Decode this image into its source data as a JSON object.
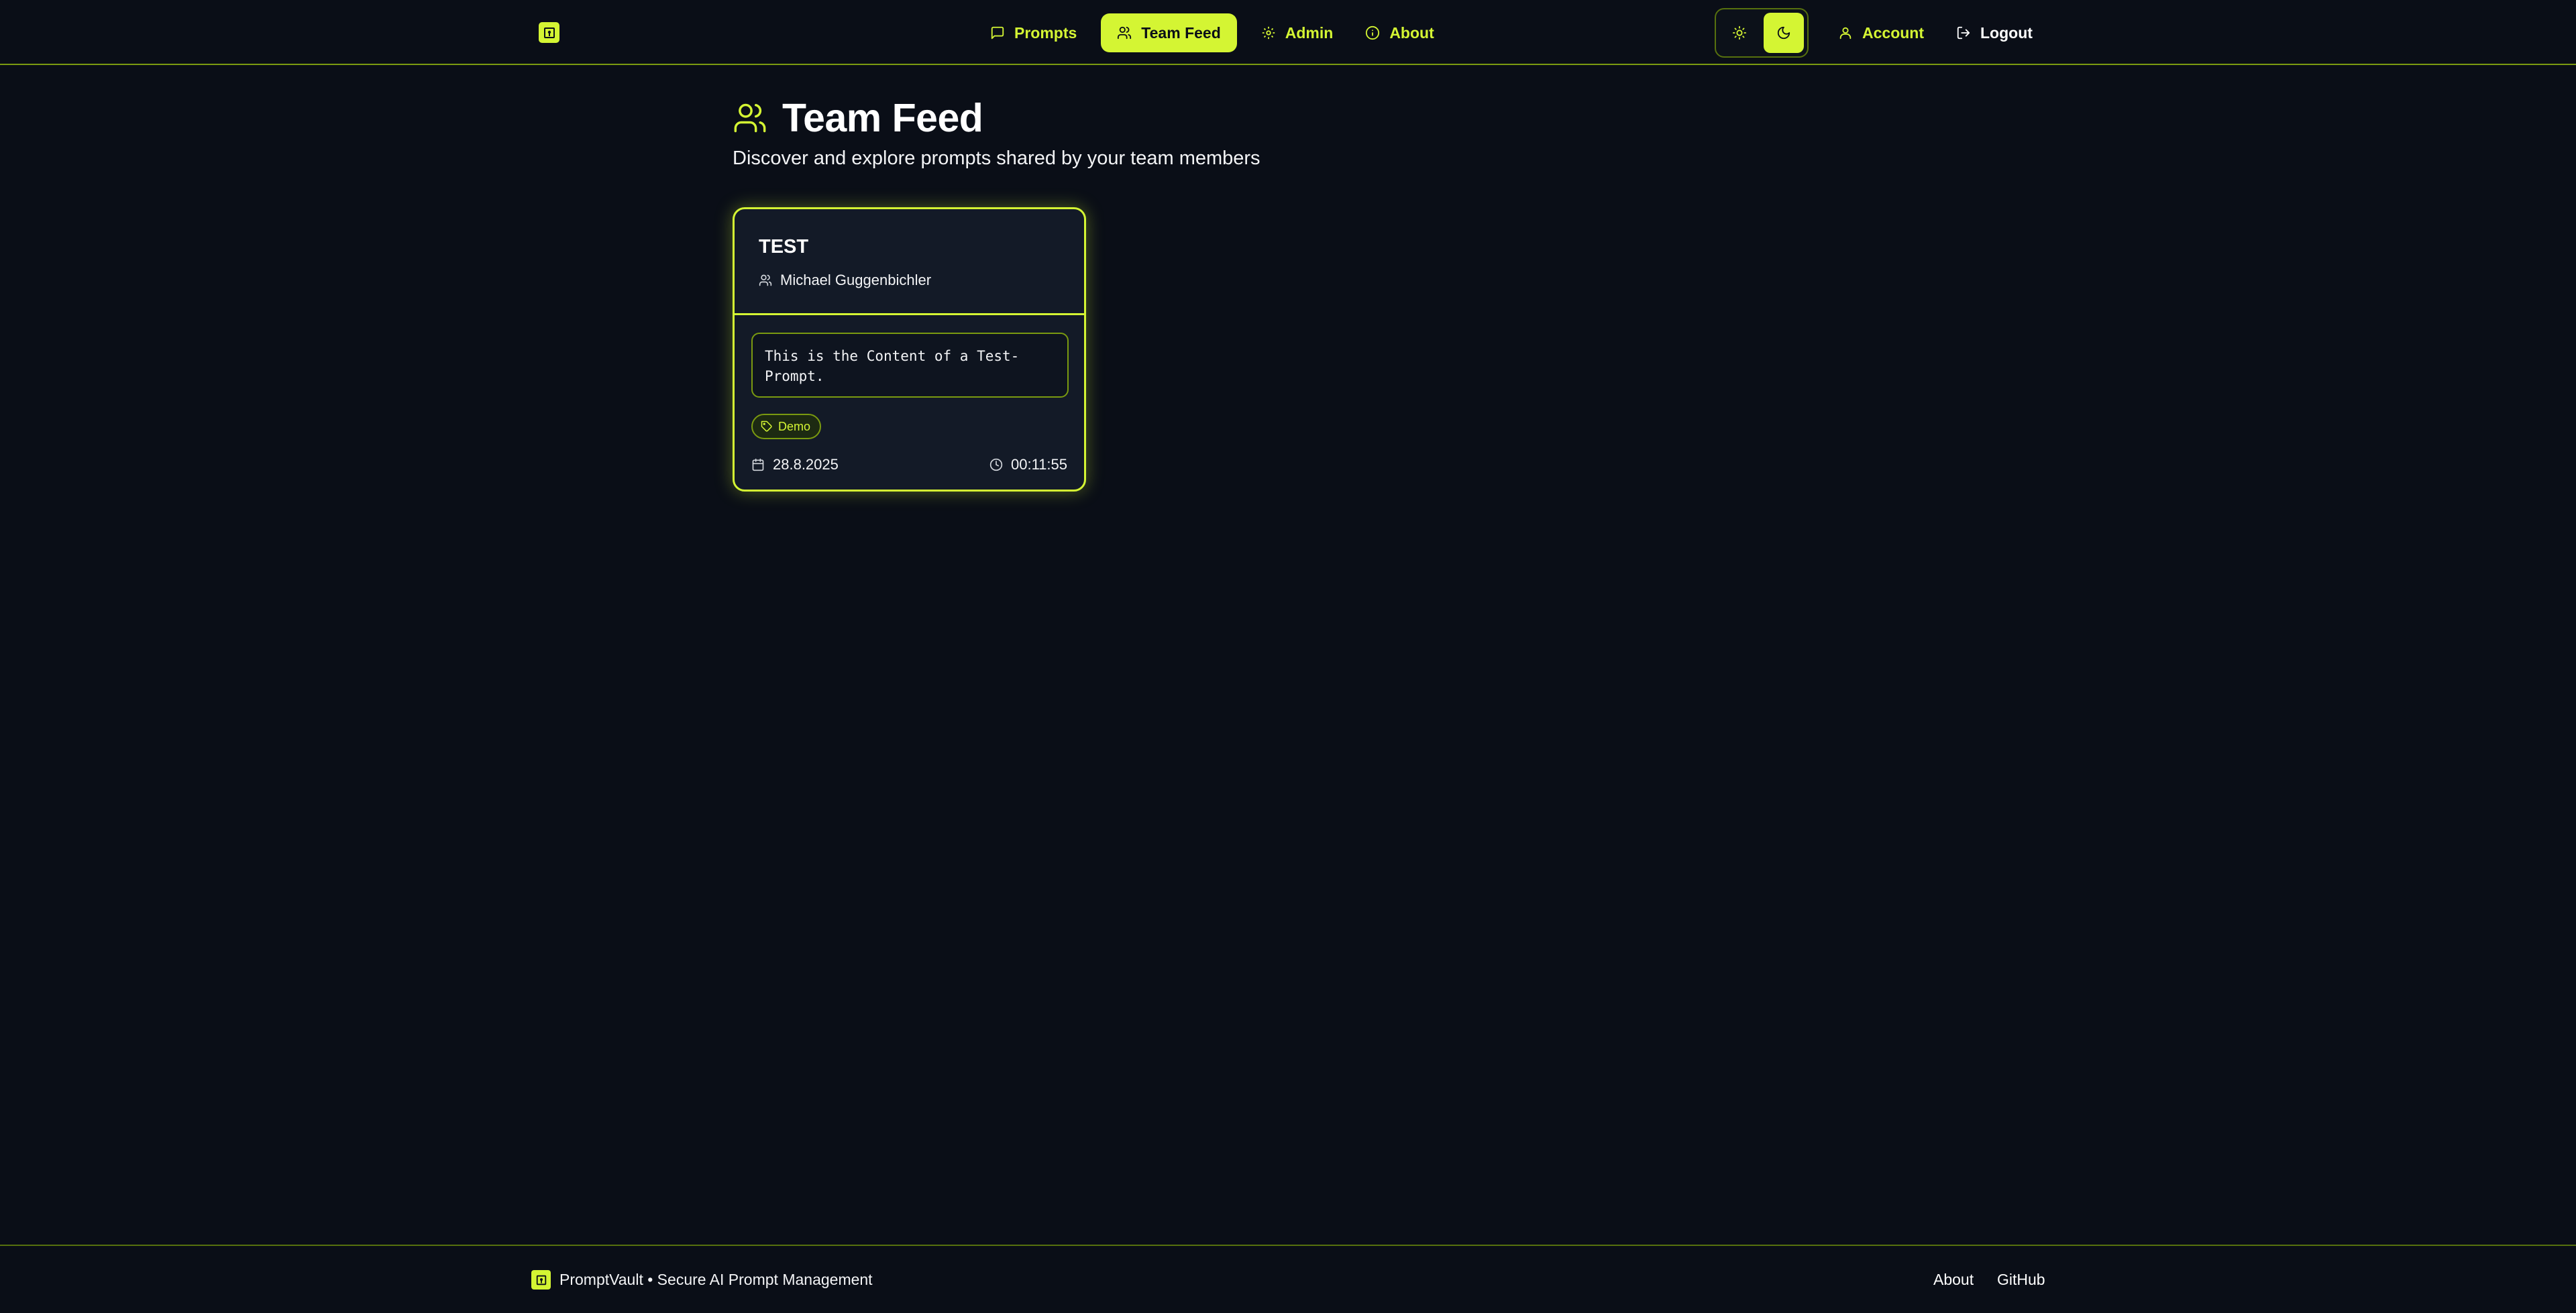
{
  "colors": {
    "accent": "#d4f533",
    "background": "#0a0e17",
    "card": "#131a27"
  },
  "header": {
    "logo_icon": "vault-icon",
    "nav": [
      {
        "label": "Prompts",
        "icon": "message-square-icon"
      },
      {
        "label": "Team Feed",
        "icon": "users-icon",
        "active": true
      },
      {
        "label": "Admin",
        "icon": "gear-icon"
      },
      {
        "label": "About",
        "icon": "info-icon"
      }
    ],
    "theme": {
      "options": [
        "light",
        "dark"
      ],
      "selected": "dark"
    },
    "account_label": "Account",
    "logout_label": "Logout"
  },
  "main": {
    "title": "Team Feed",
    "subtitle": "Discover and explore prompts shared by your team members",
    "cards": [
      {
        "title": "TEST",
        "author": "Michael Guggenbichler",
        "content": "This is the Content of a Test-Prompt.",
        "tags": [
          "Demo"
        ],
        "date": "28.8.2025",
        "time": "00:11:55"
      }
    ]
  },
  "footer": {
    "text": "PromptVault • Secure AI Prompt Management",
    "links": [
      "About",
      "GitHub"
    ]
  }
}
